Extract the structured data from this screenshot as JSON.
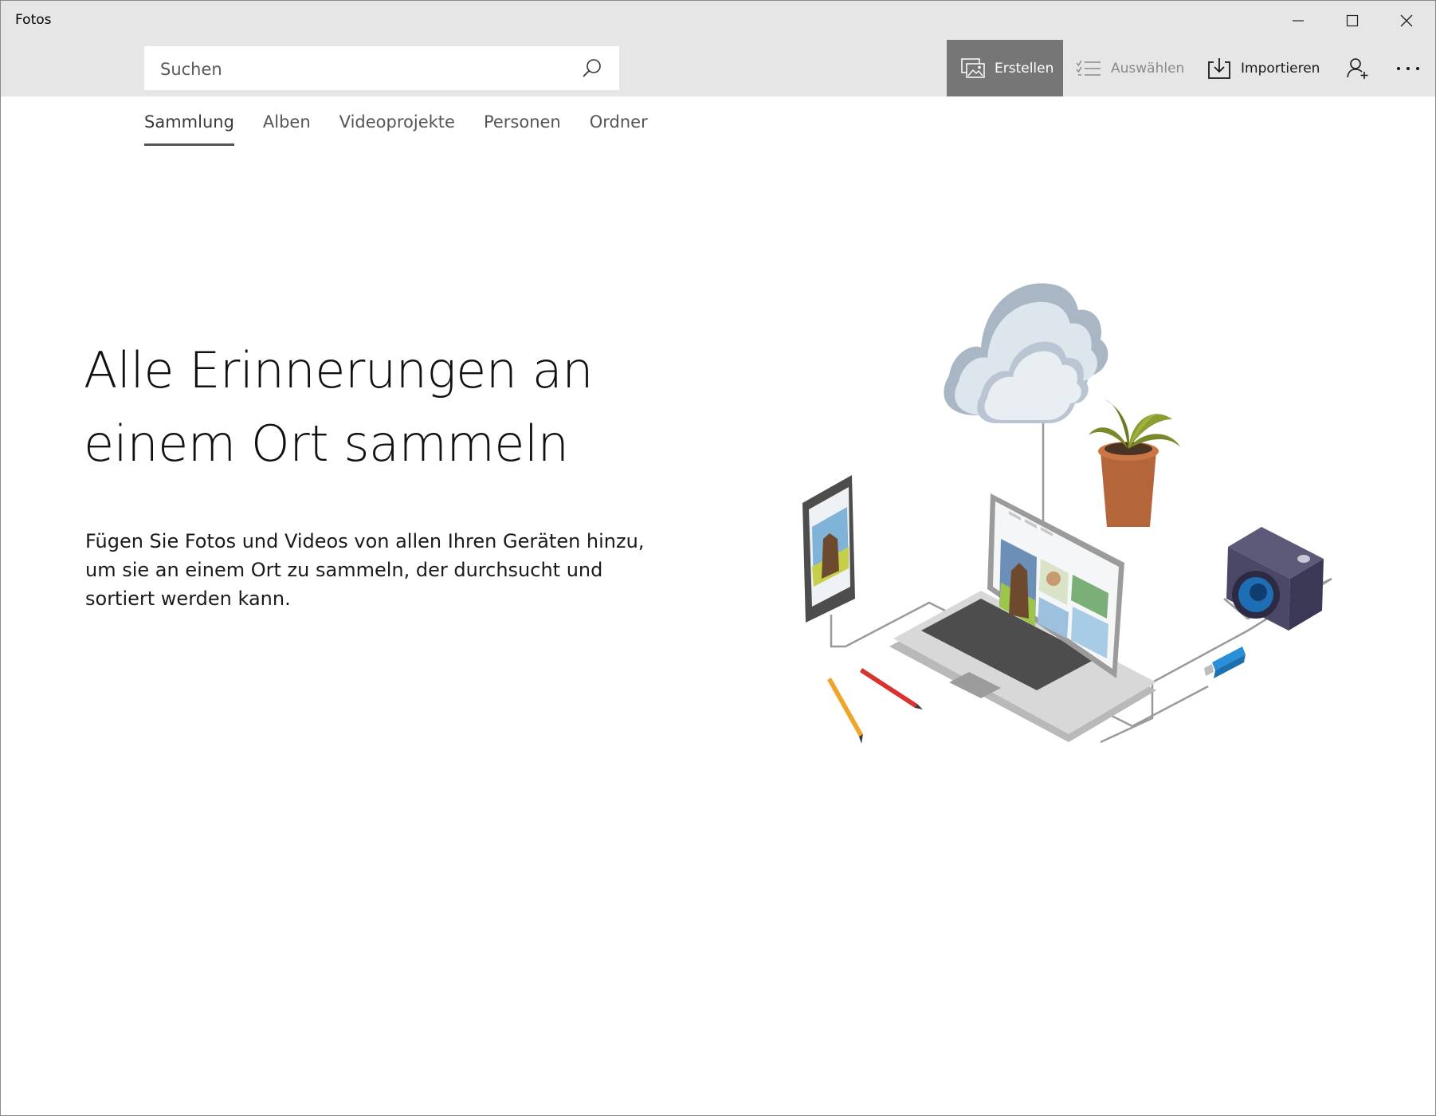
{
  "window": {
    "title": "Fotos",
    "controls": [
      "minimize-icon",
      "maximize-icon",
      "close-icon"
    ]
  },
  "search": {
    "placeholder": "Suchen",
    "value": ""
  },
  "toolbar": {
    "create_label": "Erstellen",
    "select_label": "Auswählen",
    "import_label": "Importieren",
    "account_icon": "add-user-icon",
    "more_icon": "more-icon"
  },
  "tabs": [
    {
      "label": "Sammlung",
      "active": true
    },
    {
      "label": "Alben",
      "active": false
    },
    {
      "label": "Videoprojekte",
      "active": false
    },
    {
      "label": "Personen",
      "active": false
    },
    {
      "label": "Ordner",
      "active": false
    }
  ],
  "hero": {
    "title_line1": "Alle Erinnerungen an",
    "title_line2": "einem Ort sammeln",
    "body_line1": "Fügen Sie Fotos und Videos von allen Ihren Geräten hinzu,",
    "body_line2": "um sie an einem Ort zu sammeln, der durchsucht und",
    "body_line3": "sortiert werden kann."
  },
  "colors": {
    "titlebar_bg": "#e6e6e6",
    "create_button_bg": "#767676",
    "disabled_text": "#8a8a8a"
  }
}
